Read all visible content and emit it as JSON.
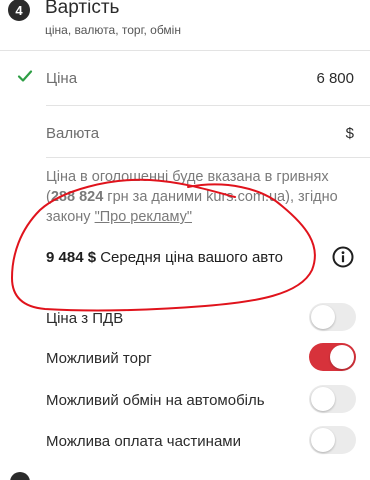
{
  "section": {
    "number": "4",
    "title": "Вартість",
    "subtitle": "ціна, валюта, торг, обмін"
  },
  "price": {
    "label": "Ціна",
    "value": "6 800",
    "status_icon": "check-icon"
  },
  "currency": {
    "label": "Валюта",
    "value": "$"
  },
  "note": {
    "line1": "Ціна в оголошенні буде вказана в гривнях",
    "open_paren": "(",
    "uah_amount": "288 824",
    "line2_rest": " грн за даними kurs.com.ua), згідно",
    "line3_prefix": "закону ",
    "law_link": "\"Про рекламу\""
  },
  "average": {
    "amount": "9 484 $",
    "label": " Середня ціна вашого авто",
    "icon": "info-icon"
  },
  "options": [
    {
      "label": "Ціна з ПДВ",
      "enabled": false
    },
    {
      "label": "Можливий торг",
      "enabled": true
    },
    {
      "label": "Можливий обмін на автомобіль",
      "enabled": false
    },
    {
      "label": "Можлива оплата частинами",
      "enabled": false
    }
  ],
  "colors": {
    "accent": "#d7323b",
    "check": "#2e9e45",
    "annotation": "#e0131c"
  }
}
